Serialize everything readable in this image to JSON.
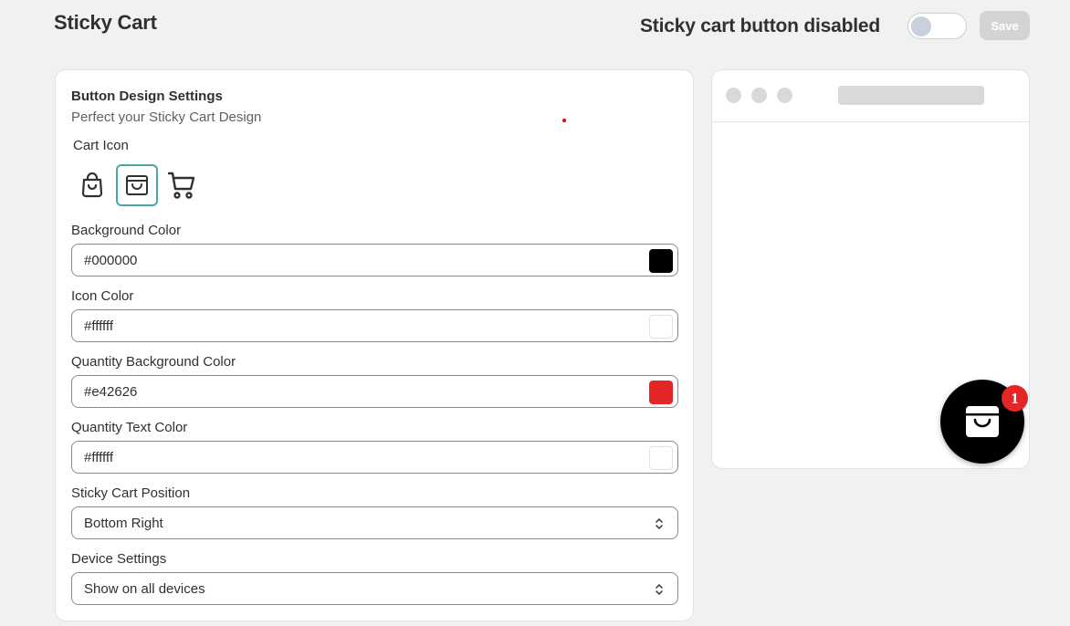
{
  "header": {
    "title": "Sticky Cart",
    "status_label": "Sticky cart button disabled",
    "toggle_enabled": false,
    "save_label": "Save"
  },
  "settings": {
    "title": "Button Design Settings",
    "subtitle": "Perfect your Sticky Cart Design",
    "cart_icon_label": "Cart Icon",
    "cart_icons": [
      "bag-icon",
      "box-bag-icon",
      "cart-icon"
    ],
    "selected_icon": "box-bag-icon",
    "background_color": {
      "label": "Background Color",
      "value": "#000000"
    },
    "icon_color": {
      "label": "Icon Color",
      "value": "#ffffff"
    },
    "qty_bg_color": {
      "label": "Quantity Background Color",
      "value": "#e42626"
    },
    "qty_text_color": {
      "label": "Quantity Text Color",
      "value": "#ffffff"
    },
    "position": {
      "label": "Sticky Cart Position",
      "value": "Bottom Right"
    },
    "device": {
      "label": "Device Settings",
      "value": "Show on all devices"
    }
  },
  "preview": {
    "badge_count": "1"
  },
  "colors": {
    "accent": "#4aa6a6",
    "save_disabled": "#d4d4d4"
  }
}
